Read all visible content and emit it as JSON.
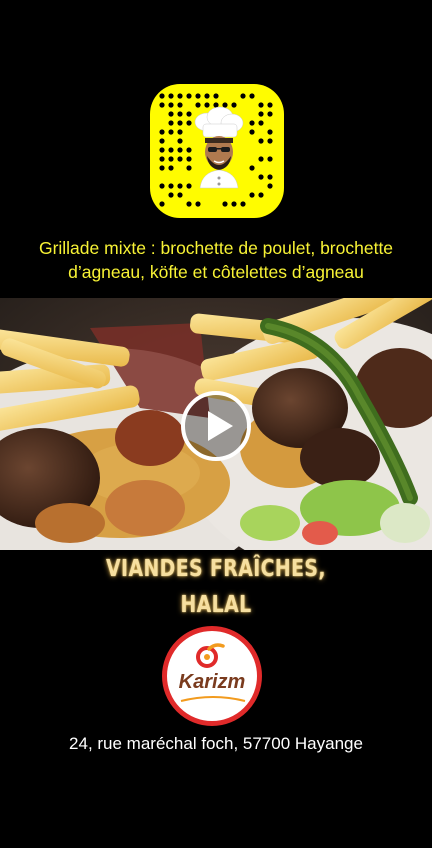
{
  "snapcode": {
    "icon": "chef-bitmoji-icon",
    "background_color": "#FFFC00"
  },
  "caption": {
    "line1": "Grillade mixte : brochette de poulet, brochette",
    "line2": "d’agneau, köfte et côtelettes d’agneau",
    "color": "#F7F235"
  },
  "video": {
    "description_icon": "play-icon"
  },
  "headline": {
    "line1": "VIANDES FRAÎCHES,",
    "line2": "HALAL",
    "color": "#F6DFA0"
  },
  "logo": {
    "name": "Karizm",
    "ring_color": "#E02A2A"
  },
  "address": "24, rue maréchal foch, 57700 Hayange"
}
